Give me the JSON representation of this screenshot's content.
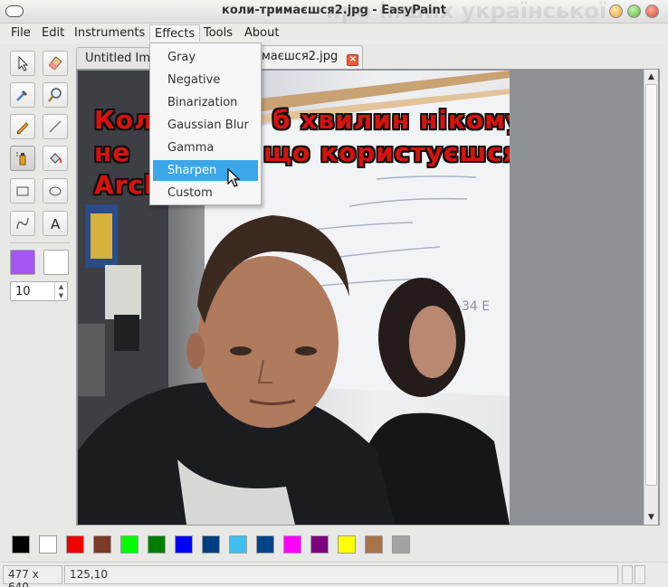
{
  "window": {
    "title": "коли-тримаєшся2.jpg - EasyPaint",
    "ghost_text": "про інших української"
  },
  "menubar": {
    "items": [
      "File",
      "Edit",
      "Instruments",
      "Effects",
      "Tools",
      "About"
    ]
  },
  "tabs": [
    {
      "label": "Untitled Im"
    },
    {
      "label": "маєшся2.jpg"
    }
  ],
  "effects_menu": {
    "items": [
      "Gray",
      "Negative",
      "Binarization",
      "Gaussian Blur",
      "Gamma",
      "Sharpen",
      "Custom"
    ],
    "highlighted": "Sharpen"
  },
  "image": {
    "caption_line1": "Кол",
    "caption_line1b": "б хвилин нікому",
    "caption_line2": "не",
    "caption_line2b": "що користуєшся",
    "caption_line3": "Arch"
  },
  "toolbox": {
    "primary_color": "#a356f0",
    "secondary_color": "#ffffff",
    "pen_size": "10"
  },
  "palette": [
    "#000000",
    "#ffffff",
    "#ee0000",
    "#7b3b28",
    "#00ff00",
    "#007f00",
    "#0000ff",
    "#003f7f",
    "#3fbfef",
    "#004488",
    "#ff00ff",
    "#7f007f",
    "#ffff00",
    "#a7754a",
    "#a3a3a3"
  ],
  "status": {
    "size": "477 x 640",
    "coords": "125,10"
  }
}
